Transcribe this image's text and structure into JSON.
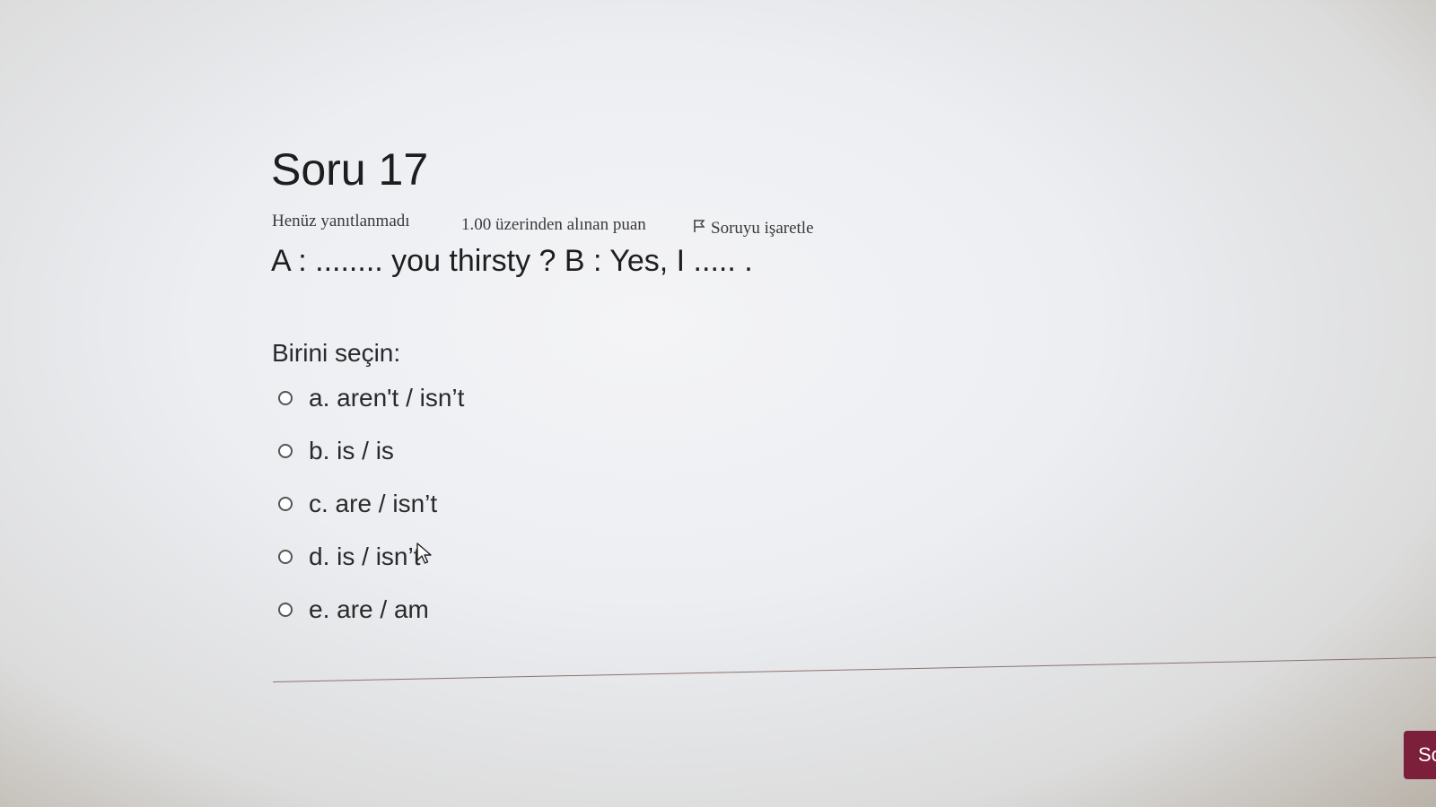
{
  "question": {
    "title": "Soru 17",
    "status": "Henüz yanıtlanmadı",
    "points": "1.00 üzerinden alınan puan",
    "flag_label": "Soruyu işaretle",
    "text": "A : ........ you thirsty ? B : Yes, I ..... ."
  },
  "answer": {
    "prompt": "Birini seçin:",
    "options": [
      {
        "label": "a. aren't / isn’t",
        "selected": false
      },
      {
        "label": "b. is / is",
        "selected": false
      },
      {
        "label": "c. are / isn’t",
        "selected": false
      },
      {
        "label": "d. is / isn’t",
        "selected": false
      },
      {
        "label": "e. are / am",
        "selected": false
      }
    ]
  },
  "navigation": {
    "next_label": "So"
  },
  "colors": {
    "button": "#7b1f3b",
    "text": "#222222"
  }
}
